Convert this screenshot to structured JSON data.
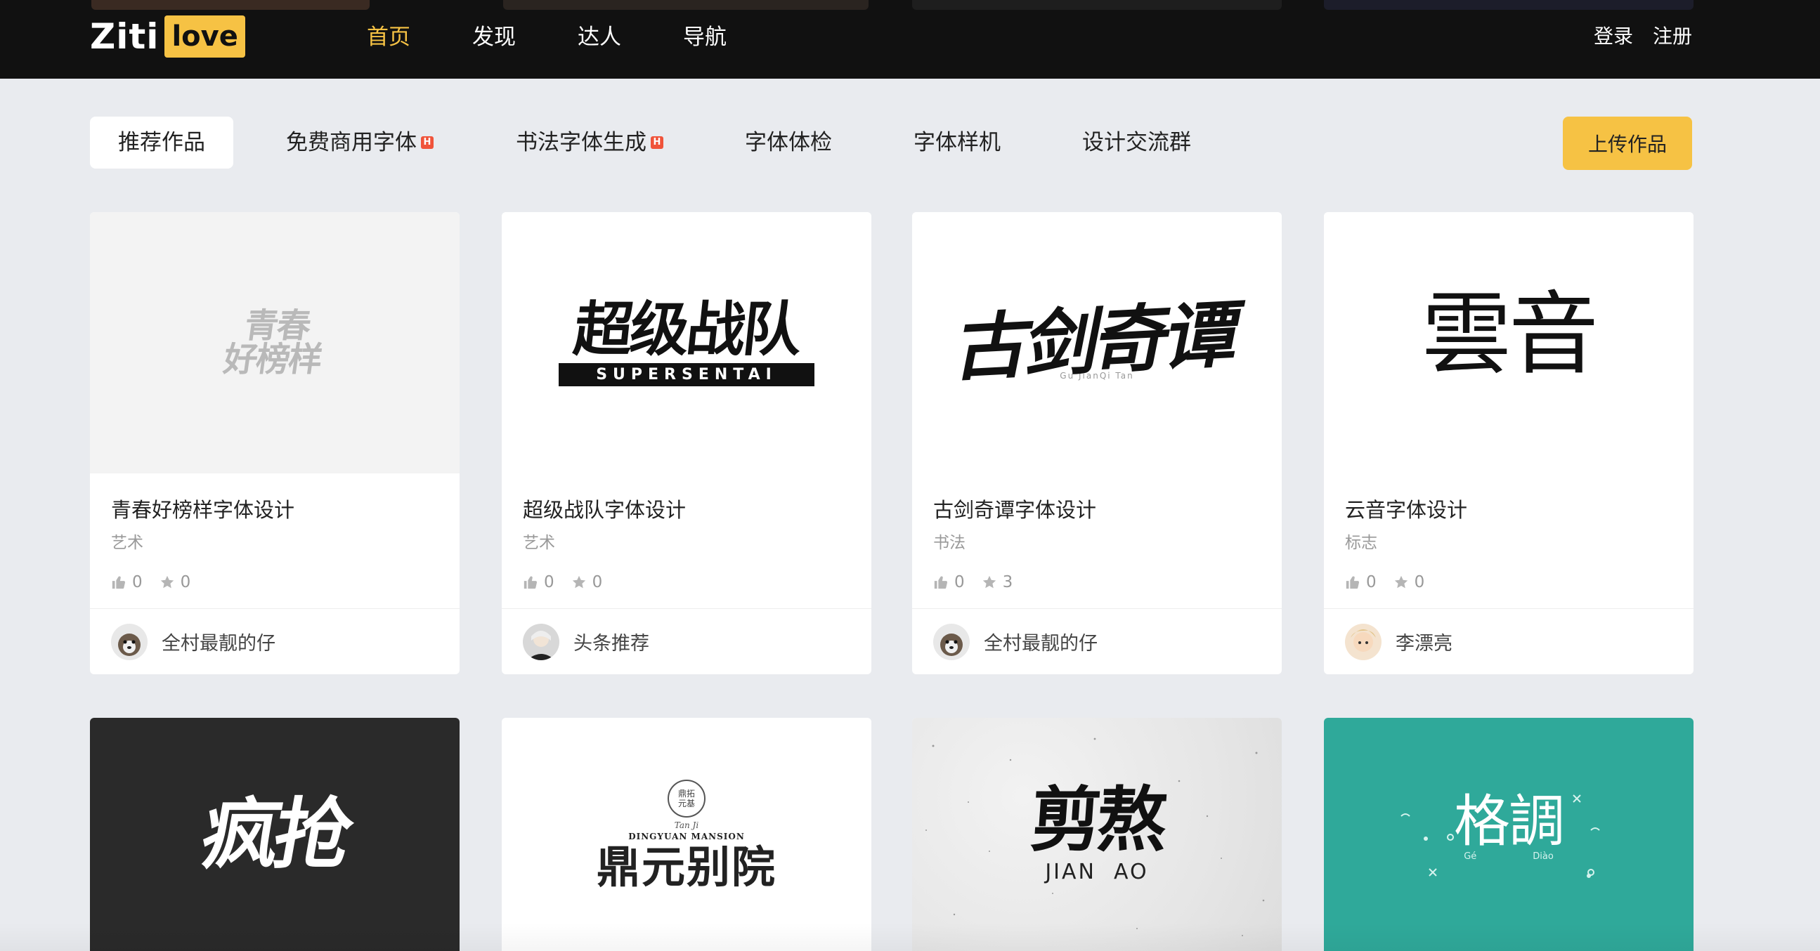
{
  "logo": {
    "part1": "Ziti",
    "part2": "love"
  },
  "nav": {
    "items": [
      {
        "label": "首页",
        "active": true
      },
      {
        "label": "发现",
        "active": false
      },
      {
        "label": "达人",
        "active": false
      },
      {
        "label": "导航",
        "active": false
      }
    ]
  },
  "auth": {
    "login": "登录",
    "register": "注册"
  },
  "subnav": {
    "tabs": [
      {
        "label": "推荐作品",
        "active": true,
        "hot": false
      },
      {
        "label": "免费商用字体",
        "active": false,
        "hot": true
      },
      {
        "label": "书法字体生成",
        "active": false,
        "hot": true
      },
      {
        "label": "字体体检",
        "active": false,
        "hot": false
      },
      {
        "label": "字体样机",
        "active": false,
        "hot": false
      },
      {
        "label": "设计交流群",
        "active": false,
        "hot": false
      }
    ],
    "hot_badge": "H",
    "upload": "上传作品"
  },
  "cards": [
    {
      "art": "青春\n好榜样",
      "title": "青春好榜样字体设计",
      "category": "艺术",
      "likes": "0",
      "stars": "0",
      "author": "全村最靓的仔"
    },
    {
      "art": "超级战队",
      "art_sub": "SUPERSENTAI",
      "title": "超级战队字体设计",
      "category": "艺术",
      "likes": "0",
      "stars": "0",
      "author": "头条推荐"
    },
    {
      "art": "古剑奇谭",
      "art_sub": "Gu JianQi Tan",
      "title": "古剑奇谭字体设计",
      "category": "书法",
      "likes": "0",
      "stars": "3",
      "author": "全村最靓的仔"
    },
    {
      "art": "雲音",
      "title": "云音字体设计",
      "category": "标志",
      "likes": "0",
      "stars": "0",
      "author": "李漂亮"
    },
    {
      "art": "疯抢"
    },
    {
      "art": "鼎元别院",
      "art_sub": "DINGYUAN MANSION",
      "art_seal": "鼎拓元基",
      "art_seal_sub": "Tan Ji"
    },
    {
      "art": "剪熬",
      "art_sub": "JIAN  AO"
    },
    {
      "art": "格調",
      "art_sub_left": "Gé",
      "art_sub_right": "Diào"
    }
  ],
  "colors": {
    "accent": "#f6c244",
    "topbar": "#111111",
    "background": "#e9ebef",
    "hot": "#f0533a",
    "teal": "#2fa99a"
  }
}
